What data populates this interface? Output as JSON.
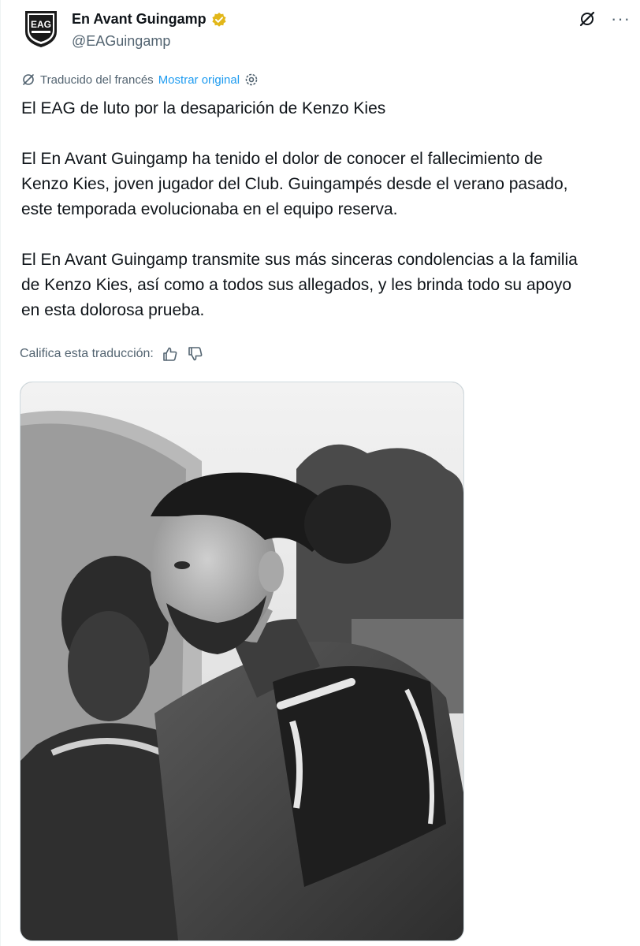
{
  "author": {
    "display_name": "En Avant Guingamp",
    "handle": "@EAGuingamp",
    "avatar_text": "EAG",
    "verified_badge_color": "#e2b719"
  },
  "icons": {
    "verified": "verified-badge-icon",
    "grok": "grok-icon",
    "more": "more-icon",
    "translate": "translate-icon",
    "settings": "settings-icon",
    "thumbs_up": "thumbs-up-icon",
    "thumbs_down": "thumbs-down-icon"
  },
  "more_label": "···",
  "translation": {
    "label": "Traducido del francés",
    "show_original": "Mostrar original",
    "rate_label": "Califica esta traducción:"
  },
  "tweet": {
    "line1": "El EAG de luto por la desaparición de Kenzo Kies",
    "p2_l1": "El En Avant Guingamp ha tenido el dolor de conocer el fallecimiento de",
    "p2_l2": "Kenzo Kies, joven jugador del Club. Guingampés desde el verano pasado,",
    "p2_l3": "este temporada evolucionaba en el equipo reserva.",
    "p3_l1": "El En Avant Guingamp transmite sus más sinceras condolencias a la familia",
    "p3_l2": "de Kenzo Kies, así como a todos sus allegados, y les brinda todo su apoyo",
    "p3_l3": "en esta dolorosa prueba."
  },
  "colors": {
    "link": "#1d9bf0",
    "secondary": "#536471",
    "text": "#0f1419"
  }
}
